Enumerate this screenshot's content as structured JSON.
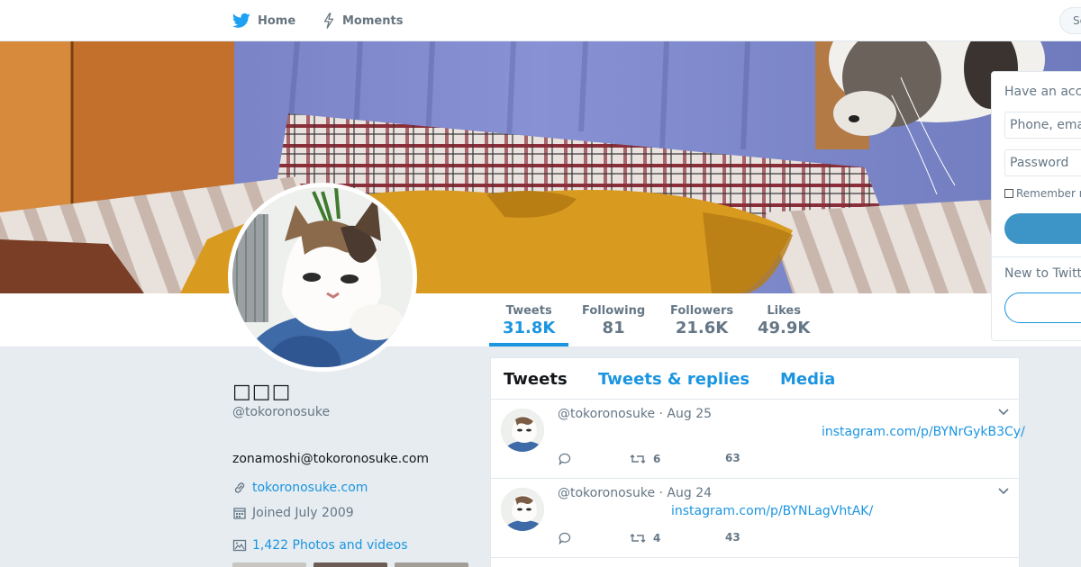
{
  "nav": {
    "home_label": "Home",
    "moments_label": "Moments",
    "search_placeholder": "Se",
    "have_account_link": "H"
  },
  "profile": {
    "name": "□□□",
    "handle": "@tokoronosuke",
    "bio": "zonamoshi@tokoronosuke.com",
    "url": "tokoronosuke.com",
    "joined": "Joined July 2009",
    "photos_link": "1,422 Photos and videos"
  },
  "stats": [
    {
      "label": "Tweets",
      "value": "31.8K"
    },
    {
      "label": "Following",
      "value": "81"
    },
    {
      "label": "Followers",
      "value": "21.6K"
    },
    {
      "label": "Likes",
      "value": "49.9K"
    }
  ],
  "timeline": {
    "tabs": [
      "Tweets",
      "Tweets & replies",
      "Media"
    ],
    "tweets": [
      {
        "handle": "@tokoronosuke",
        "date": "· Aug 25",
        "link": "instagram.com/p/BYNrGykB3Cy/",
        "retweets": "6",
        "likes": "63"
      },
      {
        "handle": "@tokoronosuke",
        "date": "· Aug 24",
        "link": "instagram.com/p/BYNLagVhtAK/",
        "retweets": "4",
        "likes": "43"
      }
    ]
  },
  "login": {
    "title": "Have an acc",
    "phone_placeholder": "Phone, ema",
    "password_placeholder": "Password",
    "remember": "Remember r",
    "new_to": "New to Twitt"
  },
  "colors": {
    "accent": "#1b95e0",
    "twitter_blue": "#1da1f2",
    "text_secondary": "#657786",
    "background": "#e6ecf0"
  },
  "icons": {
    "home": "twitter-bird-icon",
    "moments": "lightning-icon",
    "url": "link-icon",
    "joined": "calendar-icon",
    "photos": "image-icon",
    "reply": "reply-icon",
    "retweet": "retweet-icon",
    "like": "heart-icon",
    "menu": "chevron-down-icon"
  }
}
